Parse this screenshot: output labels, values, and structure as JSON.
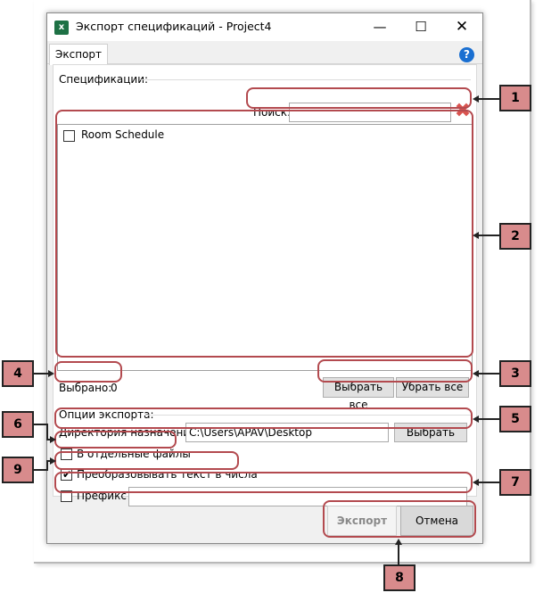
{
  "window": {
    "title": "Экспорт спецификаций - Project4",
    "app_icon": "excel-icon",
    "controls": [
      "minimize-icon",
      "maximize-icon",
      "close-icon"
    ]
  },
  "tabs": [
    {
      "label": "Экспорт",
      "active": true
    }
  ],
  "help_icon": "help-icon",
  "specs": {
    "group_label": "Спецификации:",
    "search_label": "Поиск:",
    "search_value": "",
    "items": [
      {
        "label": "Room Schedule",
        "checked": false
      }
    ],
    "selected_label": "Выбрано:",
    "selected_count": "0",
    "select_all": "Выбрать все",
    "deselect_all": "Убрать все"
  },
  "options": {
    "group_label": "Опции экспорта:",
    "dir_label": "Директория назначения:",
    "dir_value": "C:\\Users\\APAV\\Desktop",
    "browse": "Выбрать",
    "separate_files": {
      "label": "В отдельные файлы",
      "checked": false
    },
    "convert_numbers": {
      "label": "Преобразовывать текст в числа",
      "checked": true
    },
    "prefix": {
      "label": "Префикс",
      "checked": false,
      "value": ""
    }
  },
  "footer": {
    "export": "Экспорт",
    "cancel": "Отмена"
  },
  "annotations": [
    "1",
    "2",
    "3",
    "4",
    "5",
    "6",
    "7",
    "8",
    "9"
  ],
  "colors": {
    "highlight": "#b34a4f",
    "badge_fill": "#d88b8c",
    "accent": "#1a6fd1"
  }
}
